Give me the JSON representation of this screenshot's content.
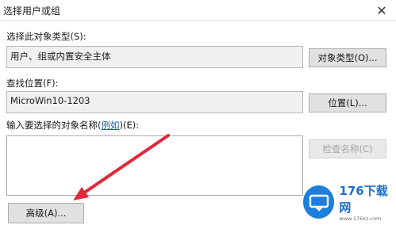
{
  "window": {
    "title": "选择用户或组",
    "close_glyph": "✕"
  },
  "object_type": {
    "label": "选择此对象类型(S):",
    "value": "用户、组或内置安全主体",
    "button": "对象类型(O)..."
  },
  "location": {
    "label": "查找位置(F):",
    "value": "MicroWin10-1203",
    "button": "位置(L)..."
  },
  "object_names": {
    "label_prefix": "输入要选择的对象名称(",
    "link": "例如",
    "label_suffix": ")(E):",
    "check_button": "检查名称(C)"
  },
  "advanced_button": "高级(A)...",
  "watermark": {
    "brand": "176下载网",
    "url": "www.176xz.com"
  },
  "colors": {
    "arrow": "#e0293a",
    "brand_blue": "#1e7fd8",
    "link": "#1a5fb4"
  }
}
